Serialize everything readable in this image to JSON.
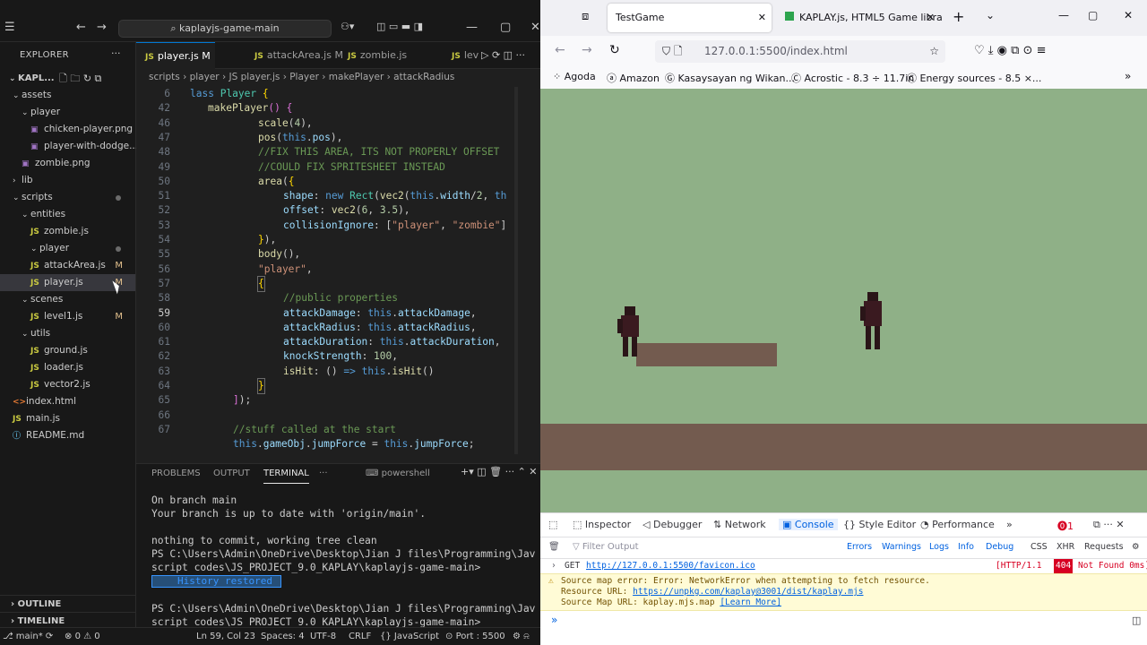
{
  "vscode": {
    "search": "kaplayjs-game-main",
    "explorer_title": "EXPLORER",
    "project": "KAPL...",
    "tree": [
      {
        "label": "assets",
        "type": "folder",
        "level": 1,
        "open": true
      },
      {
        "label": "player",
        "type": "folder",
        "level": 2,
        "open": true
      },
      {
        "label": "chicken-player.png",
        "type": "image",
        "level": 3
      },
      {
        "label": "player-with-dodge...",
        "type": "image",
        "level": 3
      },
      {
        "label": "zombie.png",
        "type": "image",
        "level": 2
      },
      {
        "label": "lib",
        "type": "folder",
        "level": 1,
        "open": false
      },
      {
        "label": "scripts",
        "type": "folder",
        "level": 1,
        "open": true,
        "dot": true
      },
      {
        "label": "entities",
        "type": "folder",
        "level": 2,
        "open": true
      },
      {
        "label": "zombie.js",
        "type": "js",
        "level": 3
      },
      {
        "label": "player",
        "type": "folder",
        "level": 3,
        "open": true,
        "dot": true
      },
      {
        "label": "attackArea.js",
        "type": "js",
        "level": 4,
        "badge": "M"
      },
      {
        "label": "player.js",
        "type": "js",
        "level": 4,
        "badge": "M",
        "selected": true
      },
      {
        "label": "scenes",
        "type": "folder",
        "level": 2,
        "open": true
      },
      {
        "label": "level1.js",
        "type": "js",
        "level": 3,
        "badge": "M"
      },
      {
        "label": "utils",
        "type": "folder",
        "level": 2,
        "open": true
      },
      {
        "label": "ground.js",
        "type": "js",
        "level": 3
      },
      {
        "label": "loader.js",
        "type": "js",
        "level": 3
      },
      {
        "label": "vector2.js",
        "type": "js",
        "level": 3
      },
      {
        "label": "index.html",
        "type": "html",
        "level": 1
      },
      {
        "label": "main.js",
        "type": "js",
        "level": 1
      },
      {
        "label": "README.md",
        "type": "md",
        "level": 1
      }
    ],
    "outline_label": "OUTLINE",
    "timeline_label": "TIMELINE",
    "tabs": [
      {
        "label": "player.js M",
        "active": true
      },
      {
        "label": "attackArea.js M",
        "active": false
      },
      {
        "label": "zombie.js",
        "active": false
      },
      {
        "label": "lev",
        "active": false
      }
    ],
    "breadcrumb": "scripts › player › JS player.js › Player › makePlayer › attackRadius",
    "line_numbers": [
      "6",
      "42",
      "46",
      "47",
      "48",
      "49",
      "50",
      "51",
      "52",
      "53",
      "54",
      "55",
      "56",
      "57",
      "58",
      "59",
      "60",
      "61",
      "62",
      "63",
      "64",
      "65",
      "66",
      "67"
    ],
    "panel_tabs": [
      "PROBLEMS",
      "OUTPUT",
      "TERMINAL",
      "···"
    ],
    "shell": "powershell",
    "terminal": [
      "On branch main",
      "Your branch is up to date with 'origin/main'.",
      "",
      "nothing to commit, working tree clean",
      "PS C:\\Users\\Admin\\OneDrive\\Desktop\\Jian J files\\Programming\\Jav",
      "script codes\\JS_PROJECT_9.0_KAPLAY\\kaplayjs-game-main>"
    ],
    "history": "History restored",
    "terminal_after": [
      "PS C:\\Users\\Admin\\OneDrive\\Desktop\\Jian J files\\Programming\\Jav",
      "script codes\\JS_PROJECT_9.0_KAPLAY\\kaplayjs-game-main>"
    ],
    "status": {
      "branch": "main*",
      "errors": "0",
      "warnings": "0",
      "position": "Ln 59, Col 23",
      "spaces": "Spaces: 4",
      "encoding": "UTF-8",
      "eol": "CRLF",
      "language": "JavaScript",
      "port": "Port : 5500"
    }
  },
  "firefox": {
    "tabs": [
      {
        "label": "TestGame",
        "active": true
      },
      {
        "label": "KAPLAY.js, HTML5 Game libra",
        "active": false
      }
    ],
    "url": "127.0.0.1:5500/index.html",
    "bookmarks": [
      "Agoda",
      "Amazon",
      "Kasaysayan ng Wikan...",
      "Acrostic - 8.3 ÷ 11.7in",
      "Energy sources - 8.5 ×..."
    ],
    "devtools_tabs": [
      "Inspector",
      "Debugger",
      "Network",
      "Console",
      "Style Editor",
      "Performance"
    ],
    "error_count": "1",
    "filter_placeholder": "Filter Output",
    "filters": [
      "Errors",
      "Warnings",
      "Logs",
      "Info",
      "Debug",
      "CSS",
      "XHR",
      "Requests"
    ],
    "log_get": {
      "method": "GET",
      "url": "http://127.0.0.1:5500/favicon.ico",
      "status": "[HTTP/1.1",
      "code": "404",
      "text": "Not Found 0ms]"
    },
    "log_warn": {
      "line1": "Source map error: Error: NetworkError when attempting to fetch resource.",
      "line2_label": "Resource URL:",
      "line2_url": "https://unpkg.com/kaplay@3001/dist/kaplay.mjs",
      "line3": "Source Map URL: kaplay.mjs.map",
      "learn": "[Learn More]"
    }
  }
}
